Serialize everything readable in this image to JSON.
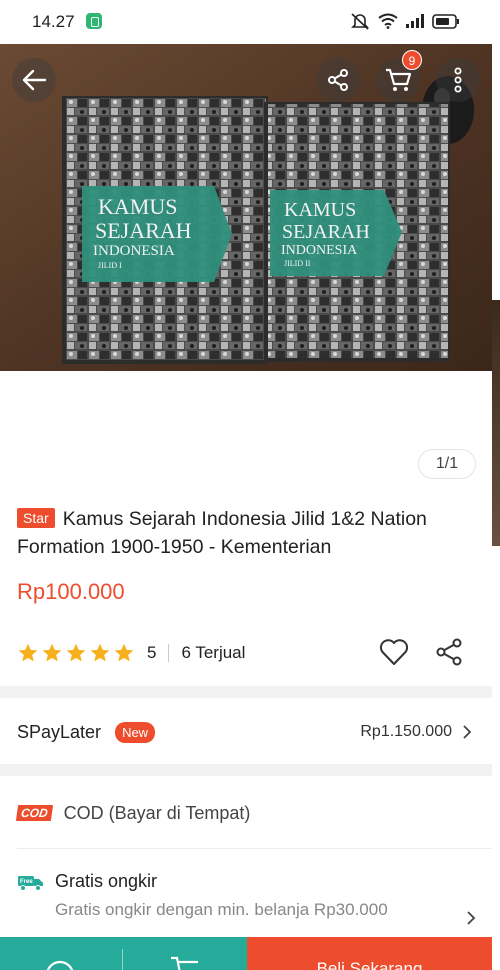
{
  "status_bar": {
    "time": "14.27"
  },
  "header": {
    "back_icon": "arrow-left-icon",
    "share_icon": "share-icon",
    "cart_icon": "cart-icon",
    "cart_badge": "9",
    "more_icon": "more-vertical-icon"
  },
  "product": {
    "image_text": {
      "cover1_line1": "KAMUS",
      "cover1_line2": "SEJARAH",
      "cover1_line3": "INDONESIA",
      "cover1_jilid": "JILID I",
      "cover2_line1": "KAMUS",
      "cover2_line2": "SEJARAH",
      "cover2_line3": "INDONESIA",
      "cover2_jilid": "JILID II"
    },
    "page_indicator": "1/1",
    "star_tag": "Star",
    "title": "Kamus Sejarah Indonesia Jilid 1&2 Nation Formation 1900-1950 - Kementerian",
    "price": "Rp100.000",
    "rating": "5",
    "sold": "6 Terjual",
    "stars": 5,
    "rating_fraction": 1.0
  },
  "spaylater": {
    "label": "SPayLater",
    "badge": "New",
    "amount": "Rp1.150.000"
  },
  "cod": {
    "badge": "COD",
    "label": "COD (Bayar di Tempat)"
  },
  "shipping": {
    "free_badge": "Free",
    "title": "Gratis ongkir",
    "subtitle": "Gratis ongkir dengan min. belanja Rp30.000"
  },
  "bottom_bar": {
    "buy_label": "Beli Sekarang"
  },
  "colors": {
    "accent": "#ee4d2d",
    "teal": "#26aa99",
    "star": "#f6b01e",
    "cover_green": "#2f8f7c"
  }
}
